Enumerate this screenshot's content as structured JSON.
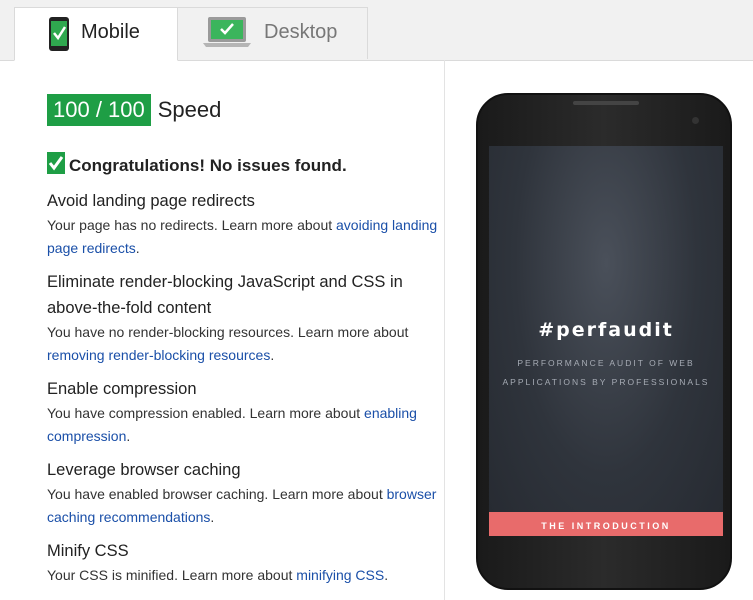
{
  "tabs": [
    {
      "label": "Mobile",
      "icon": "mobile-phone-check-icon"
    },
    {
      "label": "Desktop",
      "icon": "laptop-check-icon"
    }
  ],
  "score": {
    "value": "100 / 100",
    "label": "Speed"
  },
  "congrats": "Congratulations! No issues found.",
  "rules": [
    {
      "title": "Avoid landing page redirects",
      "desc": "Your page has no redirects. Learn more about ",
      "link": "avoiding landing page redirects",
      "after": "."
    },
    {
      "title": "Eliminate render-blocking JavaScript and CSS in above-the-fold content",
      "desc": "You have no render-blocking resources. Learn more about ",
      "link": "removing render-blocking resources",
      "after": "."
    },
    {
      "title": "Enable compression",
      "desc": "You have compression enabled. Learn more about ",
      "link": "enabling compression",
      "after": "."
    },
    {
      "title": "Leverage browser caching",
      "desc": "You have enabled browser caching. Learn more about ",
      "link": "browser caching recommendations",
      "after": "."
    },
    {
      "title": "Minify CSS",
      "desc": "Your CSS is minified. Learn more about ",
      "link": "minifying CSS",
      "after": "."
    }
  ],
  "preview": {
    "title": "#perfaudit",
    "subtitle_line1": "PERFORMANCE AUDIT OF WEB",
    "subtitle_line2": "APPLICATIONS BY PROFESSIONALS",
    "cta": "THE INTRODUCTION"
  },
  "colors": {
    "score_green": "#1e9e45",
    "link_blue": "#1a4fa8",
    "cta_red": "#e86b6b"
  }
}
